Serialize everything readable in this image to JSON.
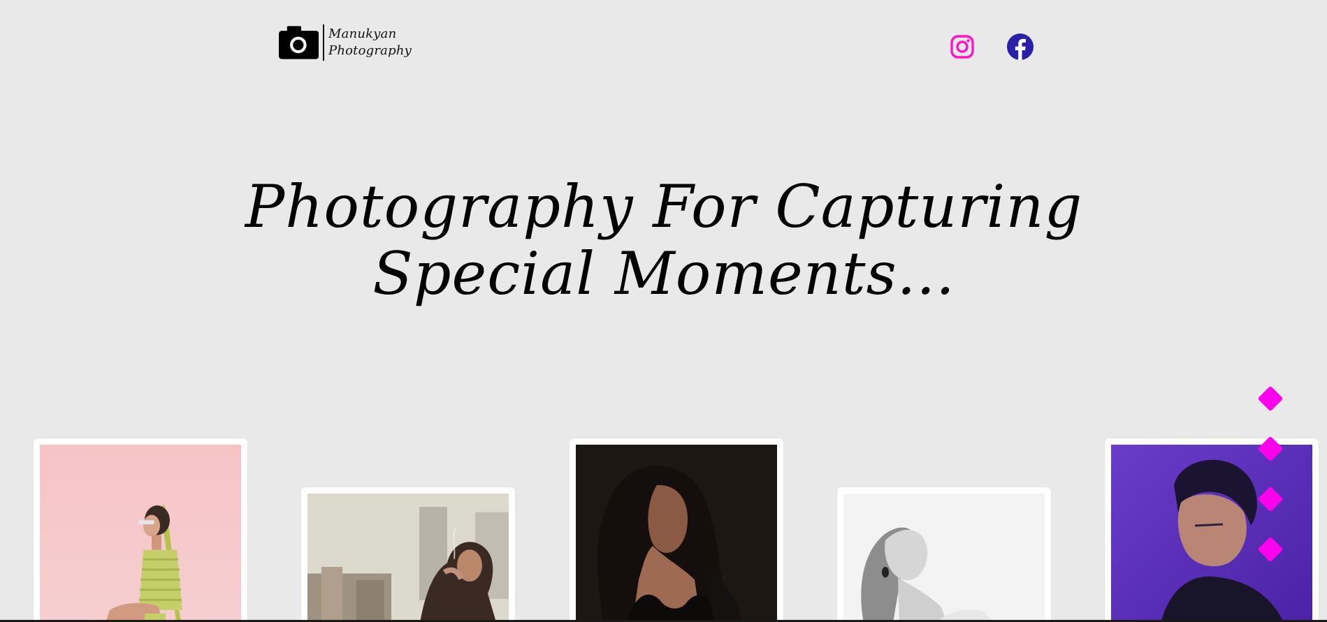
{
  "header": {
    "logo": {
      "line1": "Manukyan",
      "line2": "Photography",
      "icon": "camera-icon"
    },
    "social": [
      {
        "name": "Instagram",
        "icon": "instagram-icon",
        "color": "#ff14c8"
      },
      {
        "name": "Facebook",
        "icon": "facebook-icon",
        "color": "#2a1fa8"
      }
    ]
  },
  "hero": {
    "line1": "Photography For Capturing",
    "line2": "Special Moments..."
  },
  "gallery": {
    "photos": [
      {
        "subject": "woman-sitting-pink-background",
        "background": "#f8c9cb"
      },
      {
        "subject": "woman-smoking-rooftop",
        "background": "#d9d6cb"
      },
      {
        "subject": "woman-dark-portrait",
        "background": "#1d1714"
      },
      {
        "subject": "woman-black-and-white-portrait",
        "background": "#f2f2f2"
      },
      {
        "subject": "woman-purple-portrait",
        "background": "#5733b8"
      }
    ]
  },
  "dot_nav": {
    "count": 4,
    "color": "#ff00ee"
  },
  "colors": {
    "page_background": "#e9e9e9",
    "accent": "#ff00ee",
    "text": "#000000"
  }
}
